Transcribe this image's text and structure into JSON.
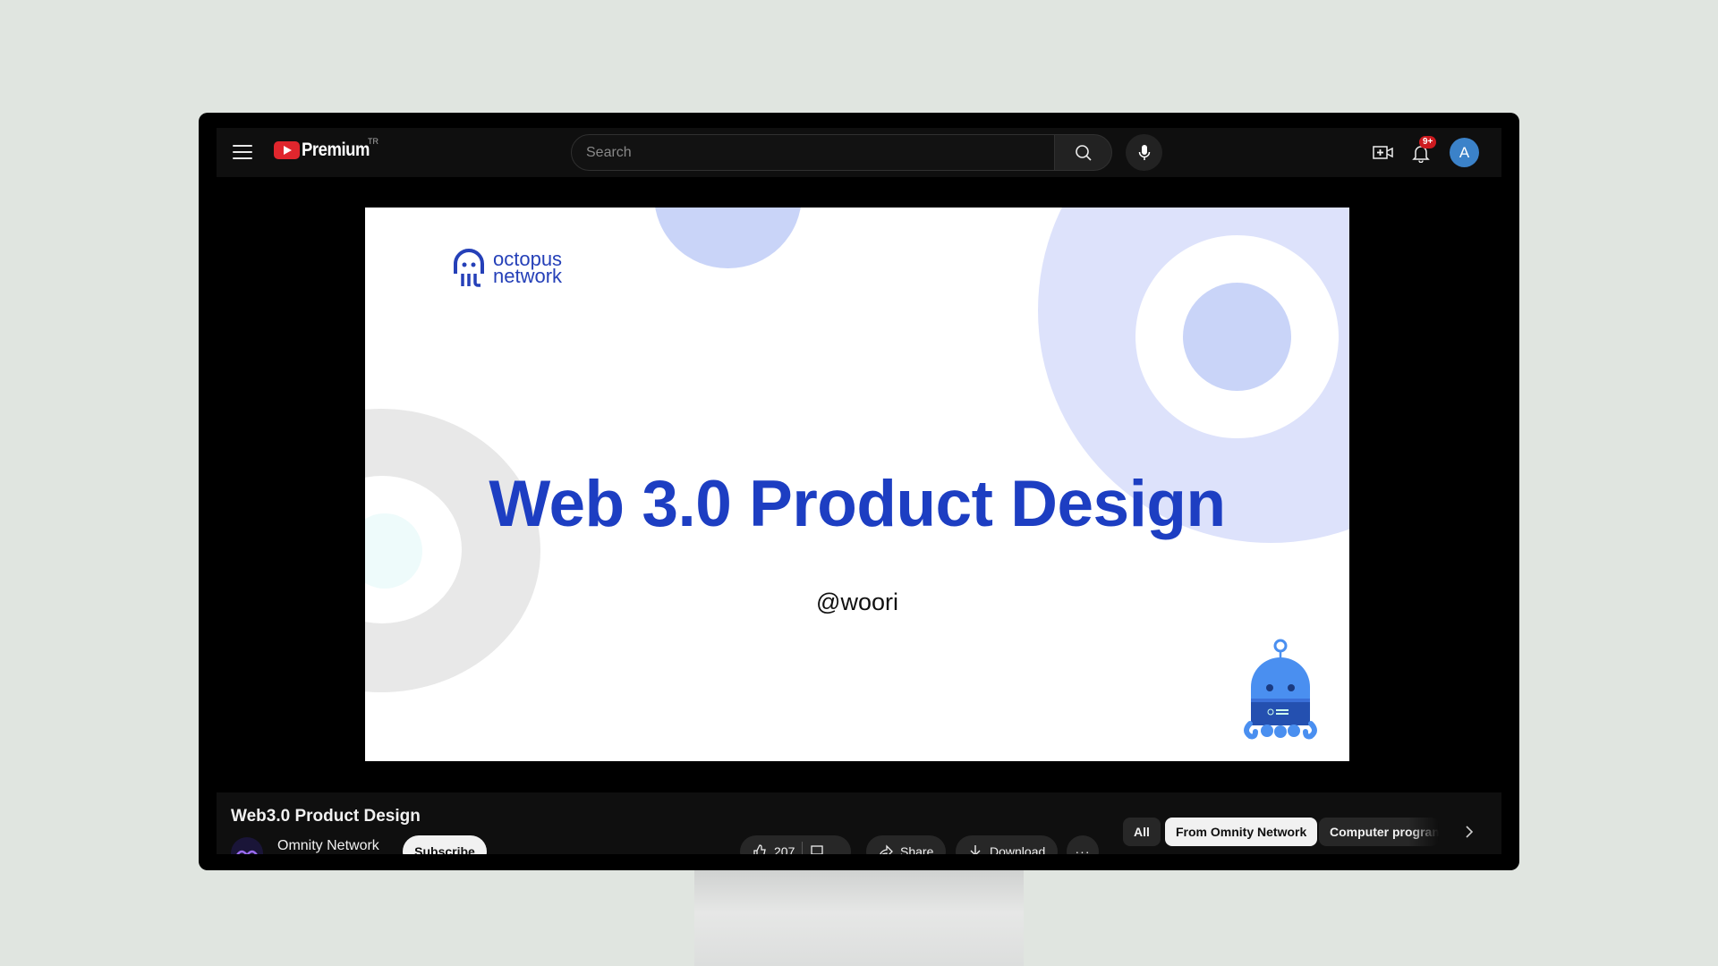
{
  "header": {
    "brand": "Premium",
    "country": "TR",
    "search_placeholder": "Search",
    "notification_badge": "9+",
    "avatar_initial": "A"
  },
  "slide": {
    "brand_line1": "octopus",
    "brand_line2": "network",
    "title": "Web 3.0 Product Design",
    "handle": "@woori",
    "colors": {
      "title": "#1d3ec2",
      "accent_light": "#dde2fb",
      "accent_mid": "#c9d4f8",
      "grey_ring": "#e8e8e8",
      "mascot": "#4a8ff0"
    }
  },
  "video": {
    "title": "Web3.0 Product Design",
    "channel": "Omnity Network",
    "subscribe_label": "Subscribe",
    "like_count": "207",
    "share_label": "Share",
    "download_label": "Download"
  },
  "chips": [
    {
      "label": "All",
      "active": false
    },
    {
      "label": "From Omnity Network",
      "active": true
    },
    {
      "label": "Computer programming",
      "active": false
    }
  ]
}
